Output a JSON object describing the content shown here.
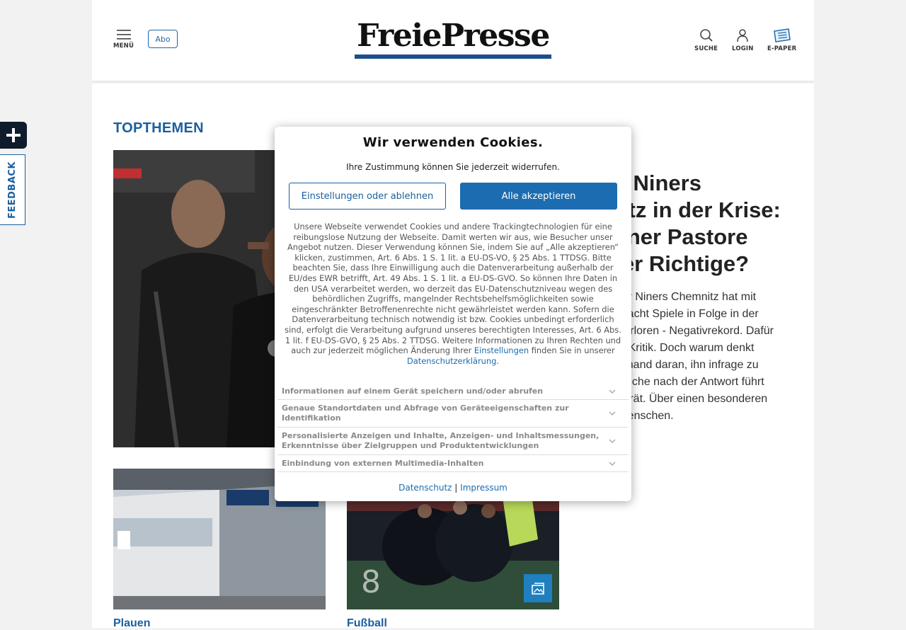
{
  "header": {
    "menu_label": "MENÜ",
    "abo_label": "Abo",
    "logo_text": "FreiePresse",
    "search_label": "SUCHE",
    "login_label": "LOGIN",
    "epaper_label": "E-PAPER"
  },
  "sidebar": {
    "feedback_label": "FEEDBACK"
  },
  "main": {
    "section_title": "TOPTHEMEN",
    "hero": {
      "title": "ie Niners\nnitz in der Krise:\nainer Pastore\nder Richtige?",
      "teaser": "r der Niners Chemnitz hat mit\nam acht Spiele in Folge in der\na verloren - Negativrekord. Dafür\nder Kritik. Doch warum denkt\nniemand daran, ihn infrage zu\ne Suche nach der Antwort führt\nPorträt. Über einen besonderen\nd Menschen."
    },
    "cards": [
      {
        "category": "Plauen"
      },
      {
        "category": "Fußball"
      }
    ]
  },
  "cookie_dialog": {
    "title": "Wir verwenden Cookies.",
    "subtitle": "Ihre Zustimmung können Sie jederzeit widerrufen.",
    "settings_button": "Einstellungen oder ablehnen",
    "accept_button": "Alle akzeptieren",
    "body_text": "Unsere Webseite verwendet Cookies und andere Trackingtechnologien für eine reibungslose Nutzung der Webseite. Damit werten wir aus, wie Besucher unser Angebot nutzen. Dieser Verwendung können Sie, indem Sie auf „Alle akzeptieren“ klicken, zustimmen, Art. 6 Abs. 1 S. 1 lit. a EU-DS-VO, § 25 Abs. 1 TTDSG. Bitte beachten Sie, dass Ihre Einwilligung auch die Datenverarbeitung außerhalb der EU/des EWR betrifft, Art. 49 Abs. 1 S. 1 lit. a EU-DS-GVO. So können Ihre Daten in den USA verarbeitet werden, wo derzeit das EU-Datenschutzniveau wegen des behördlichen Zugriffs, mangelnder Rechtsbehelfsmöglichkeiten sowie eingeschränkter Betroffenenrechte nicht gewährleistet werden kann. Sofern die Datenverarbeitung technisch notwendig ist bzw. Cookies unbedingt erforderlich sind, erfolgt die Verarbeitung aufgrund unseres berechtigten Interesses, Art. 6 Abs. 1 lit. f EU-DS-GVO, § 25 Abs. 2 TTDSG. Weitere Informationen zu Ihren Rechten und auch zur jederzeit möglichen Änderung Ihrer",
    "body_link_settings": "Einstellungen",
    "body_text_mid": "finden Sie in unserer",
    "body_link_privacy": "Datenschutzerklärung",
    "body_text_end": ".",
    "accordion": [
      "Informationen auf einem Gerät speichern und/oder abrufen",
      "Genaue Standortdaten und Abfrage von Geräteeigenschaften zur Identifikation",
      "Personalisierte Anzeigen und Inhalte, Anzeigen- und Inhaltsmessungen, Erkenntnisse über Zielgruppen und Produktentwicklungen",
      "Einbindung von externen Multimedia-Inhalten"
    ],
    "footer_privacy": "Datenschutz",
    "footer_separator": "|",
    "footer_imprint": "Impressum"
  },
  "colors": {
    "brand_blue": "#1b5f9e",
    "button_blue": "#1b6cb0",
    "logo_bar": "#1b4f8a"
  },
  "icons": [
    "menu-icon",
    "search-icon",
    "user-icon",
    "epaper-icon",
    "plus-icon",
    "chevron-down-icon",
    "gallery-icon"
  ]
}
